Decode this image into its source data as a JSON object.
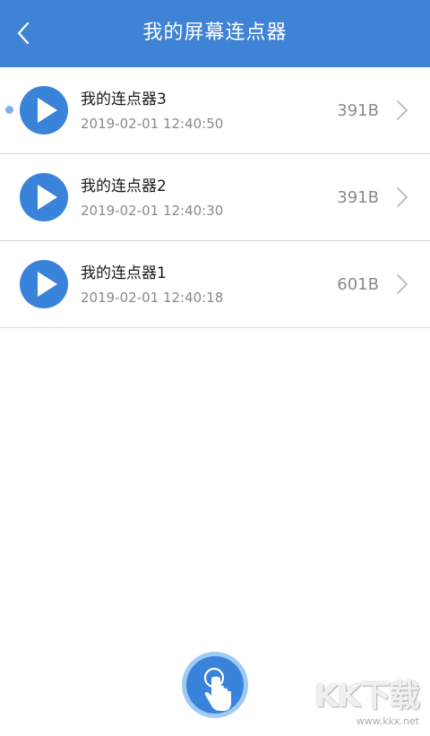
{
  "header": {
    "title": "我的屏幕连点器",
    "background_color": "#3f83d7",
    "back_icon": "chevron-left-icon"
  },
  "items": [
    {
      "name": "我的连点器3",
      "time": "2019-02-01 12:40:50",
      "size": "391B",
      "unread": true
    },
    {
      "name": "我的连点器2",
      "time": "2019-02-01 12:40:30",
      "size": "391B",
      "unread": false
    },
    {
      "name": "我的连点器1",
      "time": "2019-02-01 12:40:18",
      "size": "601B",
      "unread": false
    }
  ],
  "icons": {
    "play": "play-circle-icon",
    "row_arrow": "chevron-right-icon",
    "fab": "tap-finger-icon"
  },
  "colors": {
    "accent": "#3a83db",
    "secondary_text": "#8a8a8a",
    "unread_dot": "#7fb0e6"
  },
  "watermark": {
    "logo": "KK下载",
    "url": "www.kkx.net"
  }
}
